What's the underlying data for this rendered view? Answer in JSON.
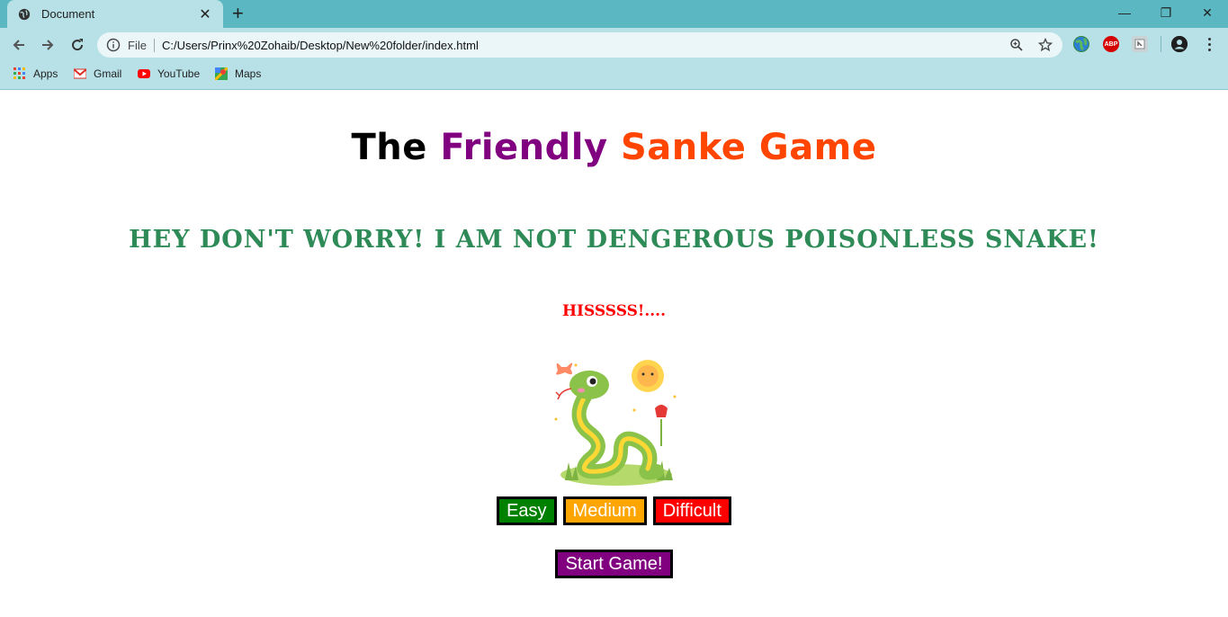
{
  "browser": {
    "tab_title": "Document",
    "address_scheme_label": "File",
    "url": "C:/Users/Prinx%20Zohaib/Desktop/New%20folder/index.html",
    "bookmarks": [
      {
        "label": "Apps",
        "icon": "apps-grid-icon"
      },
      {
        "label": "Gmail",
        "icon": "gmail-icon"
      },
      {
        "label": "YouTube",
        "icon": "youtube-icon"
      },
      {
        "label": "Maps",
        "icon": "maps-icon"
      }
    ],
    "extensions": [
      "earth-extension-icon",
      "adblock-plus-icon",
      "extension-icon"
    ],
    "extension_abp_label": "ABP"
  },
  "page": {
    "title_parts": [
      "The",
      "Friendly",
      "Sanke Game"
    ],
    "subtitle": "HEY DON'T WORRY! I AM NOT DENGEROUS POISONLESS SNAKE!",
    "hiss": "HISSSSS!....",
    "image_icon": "cartoon-snake-illustration",
    "levels": [
      {
        "label": "Easy",
        "color": "#008000"
      },
      {
        "label": "Medium",
        "color": "#ffa500"
      },
      {
        "label": "Difficult",
        "color": "#ff0000"
      }
    ],
    "start_label": "Start Game!",
    "colors": {
      "title_the": "#000000",
      "title_friendly": "#800080",
      "title_game": "#ff4500",
      "subtitle": "#2e8b57",
      "hiss": "#ff0000",
      "start": "#800080",
      "chrome_accent": "#5bb8c3"
    }
  }
}
